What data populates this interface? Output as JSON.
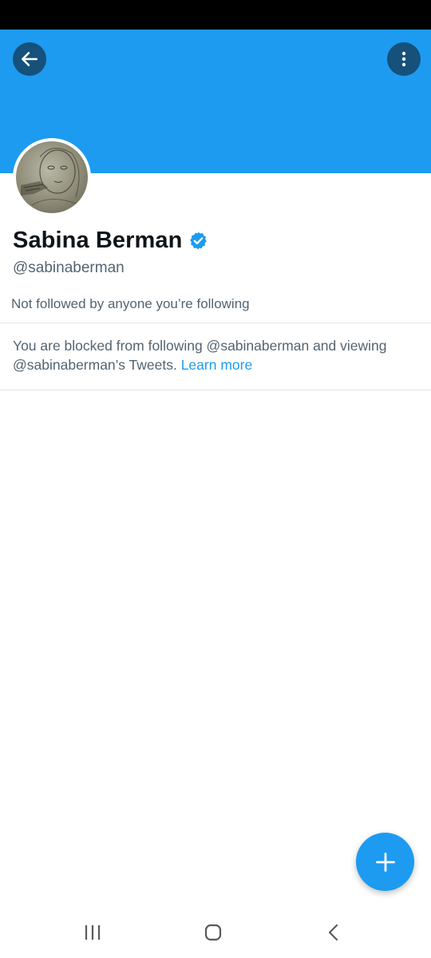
{
  "profile": {
    "display_name": "Sabina Berman",
    "handle": "@sabinaberman",
    "verified": true,
    "followers_you_know": "Not followed by anyone you’re following"
  },
  "blocked_notice": {
    "text": "You are blocked from following @sabinaberman and viewing @sabinaberman’s Tweets. ",
    "link_label": "Learn more"
  },
  "icons": {
    "back": "arrow-left-icon",
    "more": "more-vertical-icon",
    "verified": "verified-badge-icon",
    "compose": "plus-icon",
    "nav_recents": "recents-icon",
    "nav_home": "home-icon",
    "nav_back": "chevron-left-icon"
  },
  "colors": {
    "brand_blue": "#1d9bf0",
    "text_primary": "#0f1419",
    "text_secondary": "#536471"
  }
}
